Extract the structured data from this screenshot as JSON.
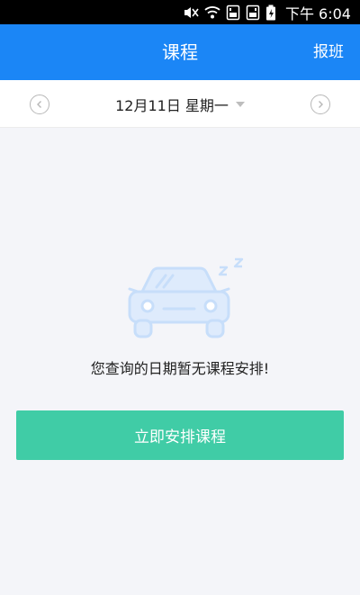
{
  "status_bar": {
    "time": "下午 6:04",
    "icons": [
      "mute-icon",
      "wifi-icon",
      "sim1-icon",
      "sim2-icon",
      "battery-icon"
    ]
  },
  "app_bar": {
    "title": "课程",
    "action_label": "报班"
  },
  "date_bar": {
    "date_text": "12月11日 星期一",
    "prev_icon": "chevron-left-icon",
    "next_icon": "chevron-right-icon",
    "dropdown_icon": "caret-down-icon"
  },
  "empty_state": {
    "illustration": "sleeping-car-icon",
    "message": "您查询的日期暂无课程安排!",
    "button_label": "立即安排课程"
  },
  "colors": {
    "app_bar": "#1b86f6",
    "button": "#40cca6",
    "background": "#f4f5f9",
    "illustration": "#c7defa"
  }
}
